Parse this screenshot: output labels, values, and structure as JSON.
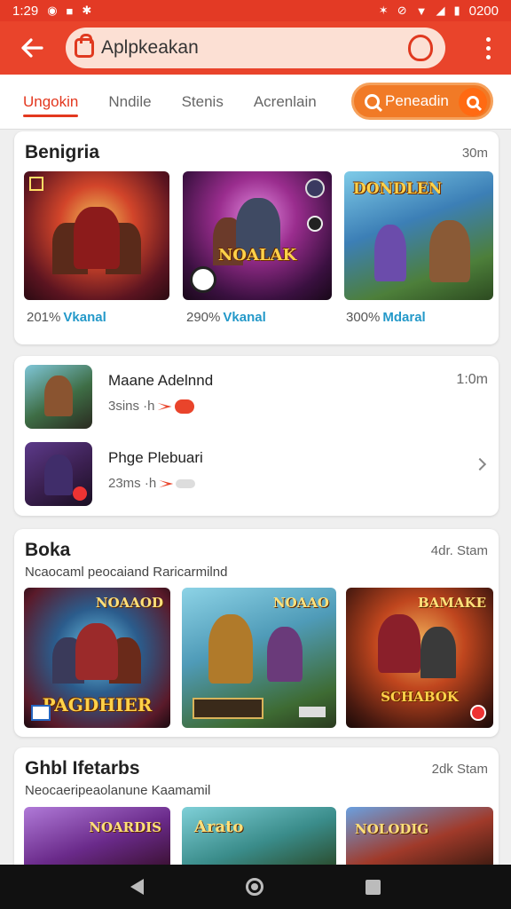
{
  "status_bar": {
    "time": "1:29",
    "right_text": "0200"
  },
  "app_bar": {
    "title": "Aplpkeakan"
  },
  "tabs": [
    {
      "label": "Ungokin",
      "active": true
    },
    {
      "label": "Nndile",
      "active": false
    },
    {
      "label": "Stenis",
      "active": false
    },
    {
      "label": "Acrenlain",
      "active": false
    }
  ],
  "tab_search": {
    "label": "Peneadin"
  },
  "section1": {
    "title": "Benigria",
    "meta": "30m",
    "items": [
      {
        "art_text": "",
        "pct": "201%",
        "publisher": "Vkanal"
      },
      {
        "art_text": "NOALAK",
        "pct": "290%",
        "publisher": "Vkanal"
      },
      {
        "art_text": "DONDLEN",
        "pct": "300%",
        "publisher": "Mdaral"
      }
    ]
  },
  "section2": {
    "items": [
      {
        "name": "Maane Adelnnd",
        "info": "3sins ·h",
        "time": "1:0m"
      },
      {
        "name": "Phge Plebuari",
        "info": "23ms ·h",
        "time": ""
      }
    ]
  },
  "section3": {
    "title": "Boka",
    "meta": "4dr. Stam",
    "subtitle": "Ncaocaml peocaiand Raricarmilnd",
    "items": [
      {
        "art_text": "PAGDHIER",
        "badge": "NOAAOD"
      },
      {
        "art_text": "",
        "badge": "NOAAO"
      },
      {
        "art_text": "SCHABOK",
        "badge": "BAMAKE"
      }
    ]
  },
  "section4": {
    "title": "Ghbl  Ifetarbs",
    "meta": "2dk Stam",
    "subtitle": "Neocaeripeaolanune Kaamamil",
    "items": [
      {
        "badge": "NOARDIS"
      },
      {
        "badge": "Arato"
      },
      {
        "badge": "NOLODIG"
      }
    ]
  },
  "colors": {
    "primary": "#e9442b",
    "accent": "#f17a26",
    "link": "#2499c9"
  },
  "icons": [
    "back-arrow-icon",
    "shopping-bag-icon",
    "shield-icon",
    "more-vert-icon",
    "search-icon",
    "chevron-right-icon",
    "nav-back-icon",
    "nav-home-icon",
    "nav-recents-icon"
  ]
}
